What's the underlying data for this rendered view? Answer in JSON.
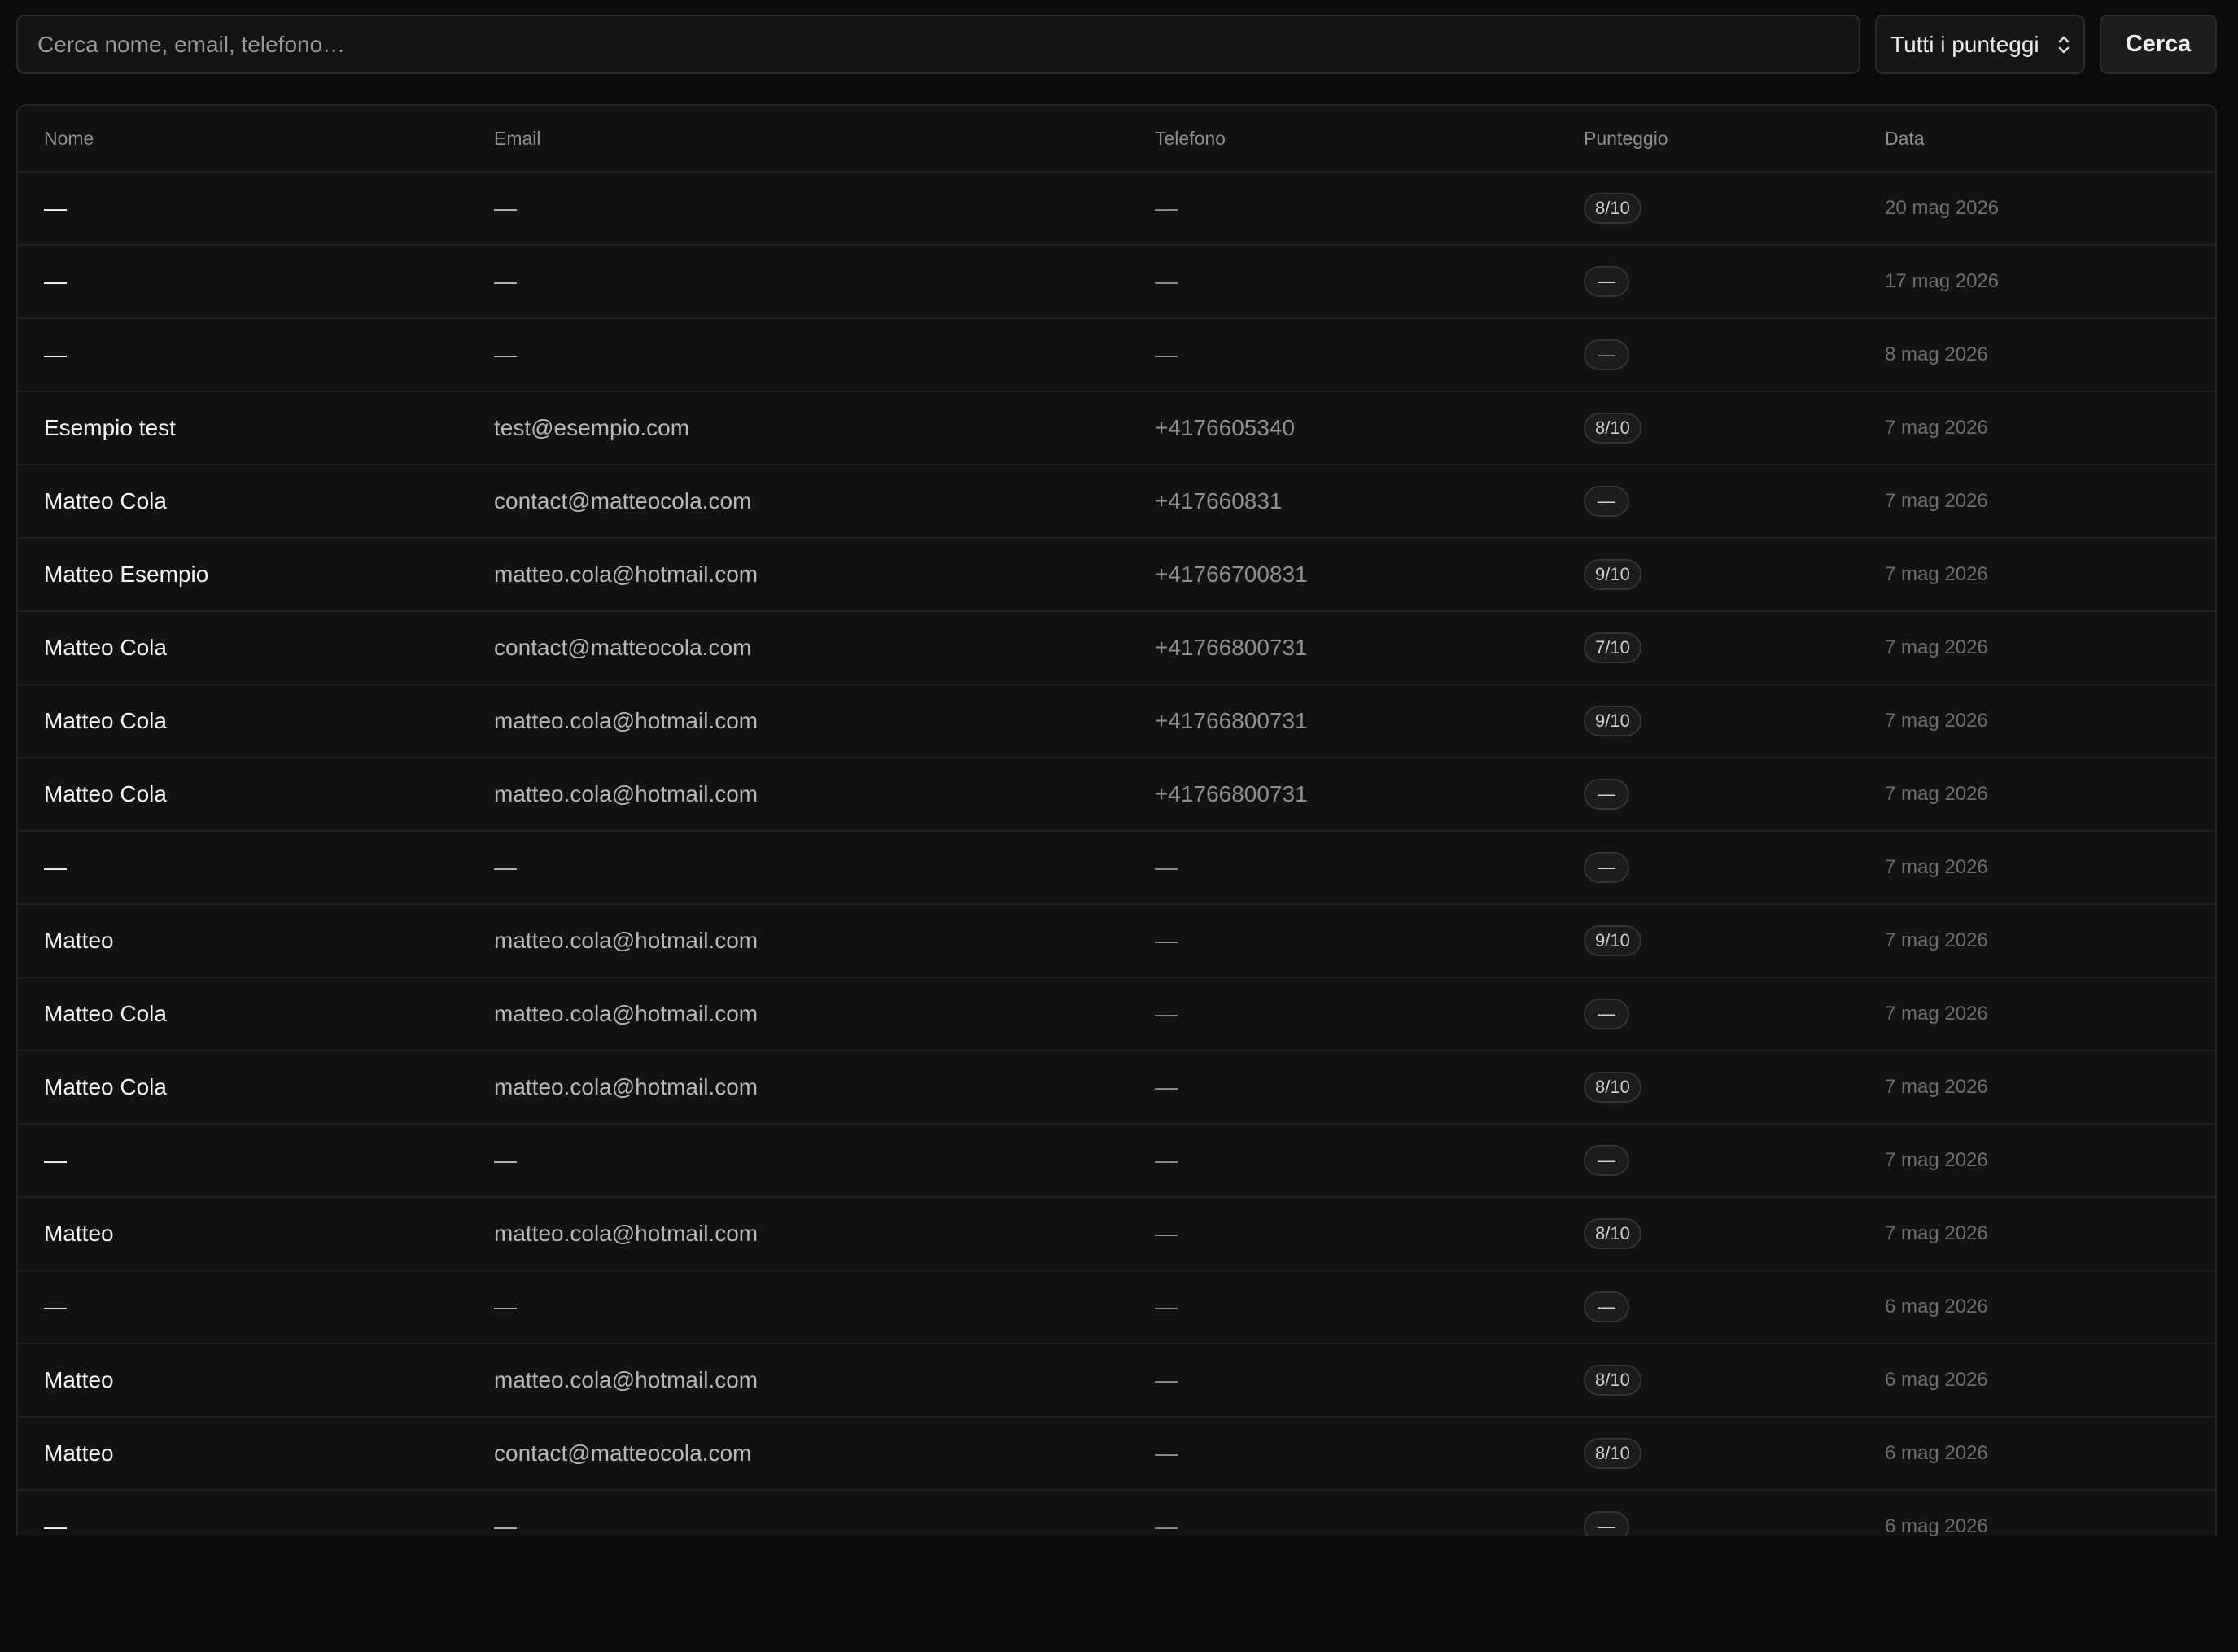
{
  "search": {
    "placeholder": "Cerca nome, email, telefono…",
    "value": ""
  },
  "filter": {
    "selected": "Tutti i punteggi"
  },
  "search_button": "Cerca",
  "table": {
    "headers": {
      "nome": "Nome",
      "email": "Email",
      "telefono": "Telefono",
      "punteggio": "Punteggio",
      "data": "Data"
    },
    "rows": [
      {
        "nome": "—",
        "email": "—",
        "telefono": "—",
        "punteggio": "8/10",
        "data": "20 mag 2026"
      },
      {
        "nome": "—",
        "email": "—",
        "telefono": "—",
        "punteggio": "—",
        "data": "17 mag 2026"
      },
      {
        "nome": "—",
        "email": "—",
        "telefono": "—",
        "punteggio": "—",
        "data": "8 mag 2026"
      },
      {
        "nome": "Esempio test",
        "email": "test@esempio.com",
        "telefono": "+4176605340",
        "punteggio": "8/10",
        "data": "7 mag 2026"
      },
      {
        "nome": "Matteo Cola",
        "email": "contact@matteocola.com",
        "telefono": "+417660831",
        "punteggio": "—",
        "data": "7 mag 2026"
      },
      {
        "nome": "Matteo Esempio",
        "email": "matteo.cola@hotmail.com",
        "telefono": "+41766700831",
        "punteggio": "9/10",
        "data": "7 mag 2026"
      },
      {
        "nome": "Matteo Cola",
        "email": "contact@matteocola.com",
        "telefono": "+41766800731",
        "punteggio": "7/10",
        "data": "7 mag 2026"
      },
      {
        "nome": "Matteo Cola",
        "email": "matteo.cola@hotmail.com",
        "telefono": "+41766800731",
        "punteggio": "9/10",
        "data": "7 mag 2026"
      },
      {
        "nome": "Matteo Cola",
        "email": "matteo.cola@hotmail.com",
        "telefono": "+41766800731",
        "punteggio": "—",
        "data": "7 mag 2026"
      },
      {
        "nome": "—",
        "email": "—",
        "telefono": "—",
        "punteggio": "—",
        "data": "7 mag 2026"
      },
      {
        "nome": "Matteo",
        "email": "matteo.cola@hotmail.com",
        "telefono": "—",
        "punteggio": "9/10",
        "data": "7 mag 2026"
      },
      {
        "nome": "Matteo Cola",
        "email": "matteo.cola@hotmail.com",
        "telefono": "—",
        "punteggio": "—",
        "data": "7 mag 2026"
      },
      {
        "nome": "Matteo Cola",
        "email": "matteo.cola@hotmail.com",
        "telefono": "—",
        "punteggio": "8/10",
        "data": "7 mag 2026"
      },
      {
        "nome": "—",
        "email": "—",
        "telefono": "—",
        "punteggio": "—",
        "data": "7 mag 2026"
      },
      {
        "nome": "Matteo",
        "email": "matteo.cola@hotmail.com",
        "telefono": "—",
        "punteggio": "8/10",
        "data": "7 mag 2026"
      },
      {
        "nome": "—",
        "email": "—",
        "telefono": "—",
        "punteggio": "—",
        "data": "6 mag 2026"
      },
      {
        "nome": "Matteo",
        "email": "matteo.cola@hotmail.com",
        "telefono": "—",
        "punteggio": "8/10",
        "data": "6 mag 2026"
      },
      {
        "nome": "Matteo",
        "email": "contact@matteocola.com",
        "telefono": "—",
        "punteggio": "8/10",
        "data": "6 mag 2026"
      },
      {
        "nome": "—",
        "email": "—",
        "telefono": "—",
        "punteggio": "—",
        "data": "6 mag 2026"
      }
    ]
  },
  "icons": {
    "filter_chevron": "chevron-up-down-icon"
  },
  "colors": {
    "background": "#0b0b0b",
    "panel": "#121212",
    "border": "#2b2b2b",
    "text_primary": "#f4f4f4",
    "text_muted": "#8e8e8e"
  }
}
